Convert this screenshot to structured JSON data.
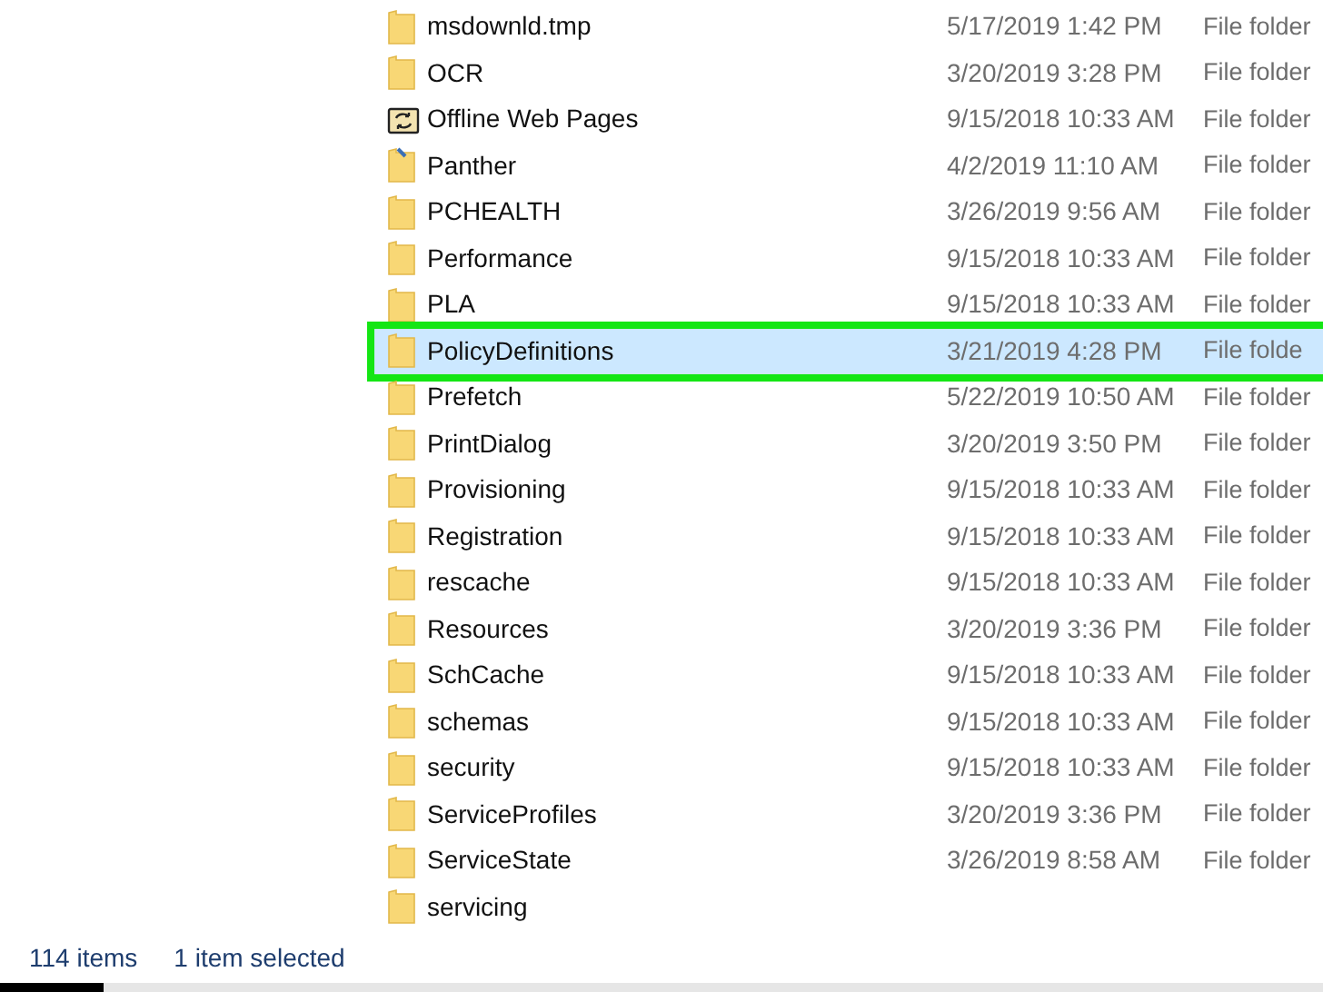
{
  "files": [
    {
      "name": "msdownld.tmp",
      "date": "5/17/2019 1:42 PM",
      "type": "File folder",
      "kind": "folder",
      "selected": false,
      "highlighted": false
    },
    {
      "name": "OCR",
      "date": "3/20/2019 3:28 PM",
      "type": "File folder",
      "kind": "folder",
      "selected": false,
      "highlighted": false
    },
    {
      "name": "Offline Web Pages",
      "date": "9/15/2018 10:33 AM",
      "type": "File folder",
      "kind": "sync",
      "selected": false,
      "highlighted": false
    },
    {
      "name": "Panther",
      "date": "4/2/2019 11:10 AM",
      "type": "File folder",
      "kind": "folder-marked",
      "selected": false,
      "highlighted": false
    },
    {
      "name": "PCHEALTH",
      "date": "3/26/2019 9:56 AM",
      "type": "File folder",
      "kind": "folder",
      "selected": false,
      "highlighted": false
    },
    {
      "name": "Performance",
      "date": "9/15/2018 10:33 AM",
      "type": "File folder",
      "kind": "folder",
      "selected": false,
      "highlighted": false
    },
    {
      "name": "PLA",
      "date": "9/15/2018 10:33 AM",
      "type": "File folder",
      "kind": "folder",
      "selected": false,
      "highlighted": false
    },
    {
      "name": "PolicyDefinitions",
      "date": "3/21/2019 4:28 PM",
      "type": "File folde",
      "kind": "folder",
      "selected": true,
      "highlighted": true
    },
    {
      "name": "Prefetch",
      "date": "5/22/2019 10:50 AM",
      "type": "File folder",
      "kind": "folder",
      "selected": false,
      "highlighted": false
    },
    {
      "name": "PrintDialog",
      "date": "3/20/2019 3:50 PM",
      "type": "File folder",
      "kind": "folder",
      "selected": false,
      "highlighted": false
    },
    {
      "name": "Provisioning",
      "date": "9/15/2018 10:33 AM",
      "type": "File folder",
      "kind": "folder",
      "selected": false,
      "highlighted": false
    },
    {
      "name": "Registration",
      "date": "9/15/2018 10:33 AM",
      "type": "File folder",
      "kind": "folder",
      "selected": false,
      "highlighted": false
    },
    {
      "name": "rescache",
      "date": "9/15/2018 10:33 AM",
      "type": "File folder",
      "kind": "folder",
      "selected": false,
      "highlighted": false
    },
    {
      "name": "Resources",
      "date": "3/20/2019 3:36 PM",
      "type": "File folder",
      "kind": "folder",
      "selected": false,
      "highlighted": false
    },
    {
      "name": "SchCache",
      "date": "9/15/2018 10:33 AM",
      "type": "File folder",
      "kind": "folder",
      "selected": false,
      "highlighted": false
    },
    {
      "name": "schemas",
      "date": "9/15/2018 10:33 AM",
      "type": "File folder",
      "kind": "folder",
      "selected": false,
      "highlighted": false
    },
    {
      "name": "security",
      "date": "9/15/2018 10:33 AM",
      "type": "File folder",
      "kind": "folder",
      "selected": false,
      "highlighted": false
    },
    {
      "name": "ServiceProfiles",
      "date": "3/20/2019 3:36 PM",
      "type": "File folder",
      "kind": "folder",
      "selected": false,
      "highlighted": false
    },
    {
      "name": "ServiceState",
      "date": "3/26/2019 8:58 AM",
      "type": "File folder",
      "kind": "folder",
      "selected": false,
      "highlighted": false
    },
    {
      "name": "servicing",
      "kind": "folder",
      "selected": false,
      "highlighted": false
    }
  ],
  "status_bar": {
    "item_count": "114 items",
    "selection": "1 item selected"
  }
}
